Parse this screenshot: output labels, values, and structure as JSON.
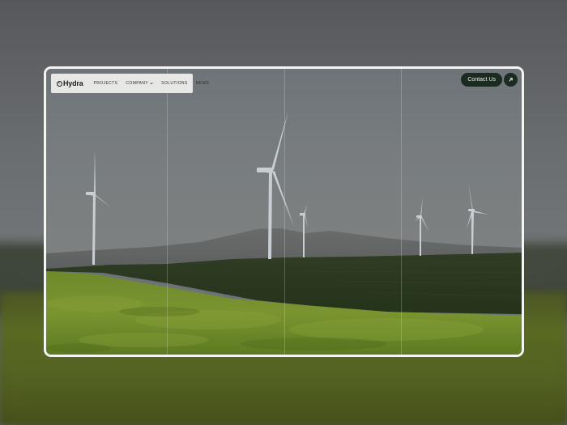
{
  "nav": {
    "logo": "Hydra",
    "items": [
      {
        "label": "PROJECTS"
      },
      {
        "label": "COMPANY",
        "has_dropdown": true
      },
      {
        "label": "SOLUTIONS"
      },
      {
        "label": "NEWS"
      }
    ]
  },
  "cta": {
    "label": "Contact Us",
    "icon": "arrow-up-right-icon"
  },
  "hero": {
    "image": "wind-turbines-over-green-fields",
    "column_count": 4
  },
  "colors": {
    "nav_bg": "#e7e8e6",
    "cta_bg": "#1c2b22",
    "frame_border": "#f4f6f3",
    "field_green": "#6a8a2a"
  }
}
